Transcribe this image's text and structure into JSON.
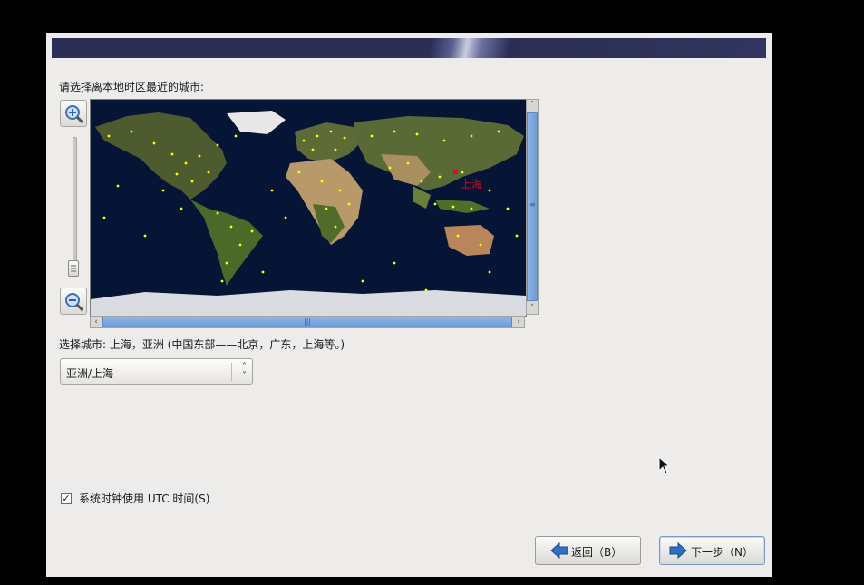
{
  "window": {
    "prompt": "请选择离本地时区最近的城市:",
    "map": {
      "selected_city_label": "上海",
      "selected_marker": "x"
    },
    "selected_city_text": "选择城市: 上海，亚洲 (中国东部——北京，广东，上海等。)",
    "timezone_combo": {
      "value": "亚洲/上海"
    },
    "utc_checkbox": {
      "checked_mark": "✓",
      "label": "系统时钟使用 UTC 时间(S)"
    },
    "buttons": {
      "back": "返回（B）",
      "next": "下一步（N）"
    },
    "icons": {
      "zoom_in": "zoom-in-icon",
      "zoom_out": "zoom-out-icon",
      "back_arrow": "arrow-left-icon",
      "next_arrow": "arrow-right-icon"
    },
    "colors": {
      "banner": "#2b2f57",
      "map_ocean": "#061535",
      "city_dot": "#ffff00",
      "selected_city": "#e0001a",
      "arrow_blue": "#2f6fc4"
    }
  }
}
